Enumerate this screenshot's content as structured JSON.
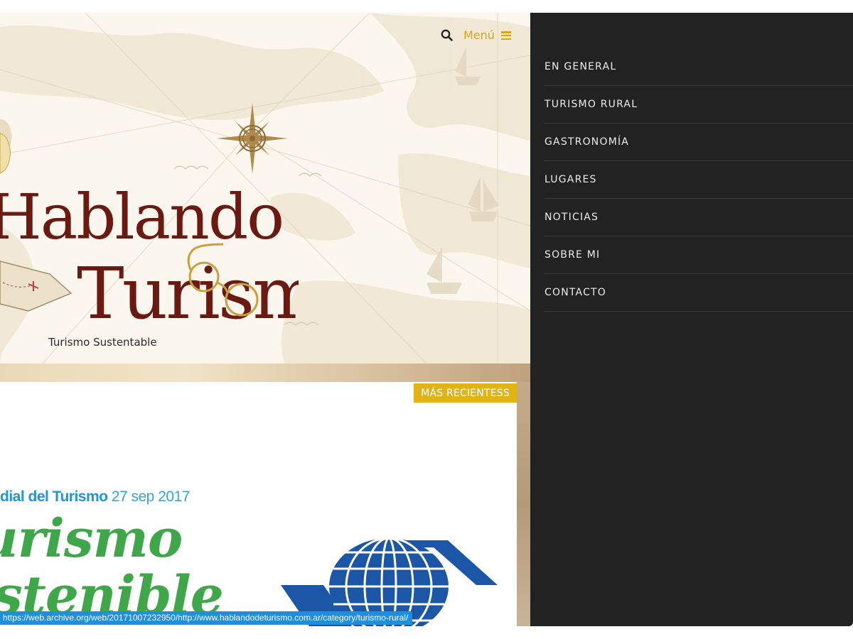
{
  "header": {
    "menu_label": "Menú",
    "search_icon": "search-icon",
    "menu_icon": "hamburger-icon"
  },
  "logo": {
    "line1": "Hablando de",
    "line2": "Turismo",
    "tagline": "Turismo Sustentable"
  },
  "content": {
    "badge": "MÁS RECIENTESS",
    "caption_bold": "dial del Turismo",
    "caption_date": "27 sep 2017",
    "big_title_line1": "urismo",
    "big_title_line2": "stenible"
  },
  "nav_menu": {
    "items": [
      {
        "label": "EN GENERAL"
      },
      {
        "label": "TURISMO RURAL"
      },
      {
        "label": "GASTRONOMÍA"
      },
      {
        "label": "LUGARES"
      },
      {
        "label": "NOTICIAS"
      },
      {
        "label": "SOBRE MI"
      },
      {
        "label": "CONTACTO"
      }
    ]
  },
  "status_bar": {
    "url": "https://web.archive.org/web/20171007232950/http://www.hablandodeturismo.com.ar/category/turismo-rural/"
  },
  "colors": {
    "accent": "#d7a516",
    "badge": "#e0b416",
    "menu_bg": "#222222",
    "logo_text": "#6b1a12",
    "status_bar": "#1e8fde",
    "poster_green": "#3fa64a",
    "poster_blue": "#1f95d4",
    "globe_blue": "#1b57a6"
  }
}
